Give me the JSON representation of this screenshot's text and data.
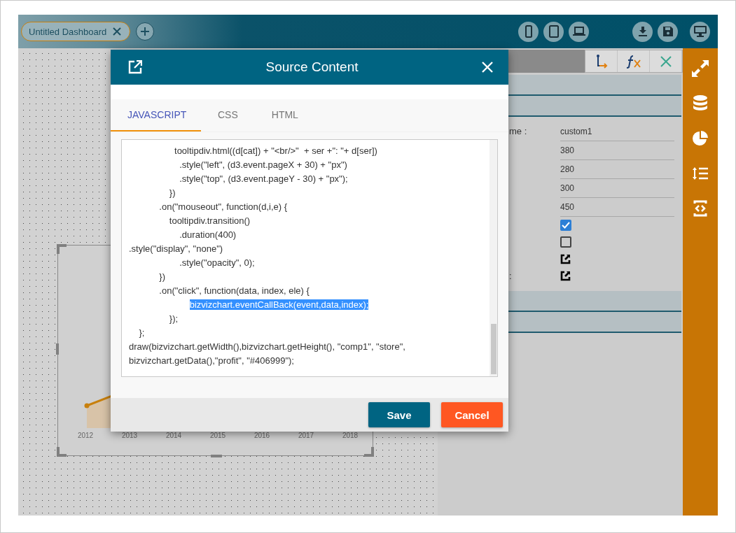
{
  "dashboard_tabs": [
    {
      "label": "Untitled Dashboard",
      "selected": true
    }
  ],
  "chart_widget": {
    "x_labels": [
      "2012",
      "2013",
      "2014",
      "2015",
      "2016",
      "2017",
      "2018"
    ]
  },
  "properties": {
    "rows": [
      {
        "kind": "text",
        "label": "me :",
        "value": "custom1"
      },
      {
        "kind": "text",
        "value": "380"
      },
      {
        "kind": "text",
        "value": "280"
      },
      {
        "kind": "text",
        "value": "300"
      },
      {
        "kind": "text",
        "value": "450"
      },
      {
        "kind": "checkbox",
        "checked": true
      },
      {
        "kind": "checkbox",
        "checked": false
      },
      {
        "kind": "link"
      },
      {
        "kind": "link",
        "label": ":"
      }
    ]
  },
  "modal": {
    "title": "Source Content",
    "tabs": [
      {
        "label": "JAVASCRIPT",
        "selected": true
      },
      {
        "label": "CSS",
        "selected": false
      },
      {
        "label": "HTML",
        "selected": false
      }
    ],
    "code_lines": [
      {
        "text": "                  tooltipdiv.html((d[cat]) + \"<br/>\"  + ser +\": \"+ d[ser])",
        "highlighted": false
      },
      {
        "text": "                    .style(\"left\", (d3.event.pageX + 30) + \"px\")",
        "highlighted": false
      },
      {
        "text": "                    .style(\"top\", (d3.event.pageY - 30) + \"px\");",
        "highlighted": false
      },
      {
        "text": "                })",
        "highlighted": false
      },
      {
        "text": "            .on(\"mouseout\", function(d,i,e) {",
        "highlighted": false
      },
      {
        "text": "                tooltipdiv.transition()",
        "highlighted": false
      },
      {
        "text": "                    .duration(400)",
        "highlighted": false
      },
      {
        "text": ".style(\"display\", \"none\")",
        "highlighted": false
      },
      {
        "text": "                    .style(\"opacity\", 0);",
        "highlighted": false
      },
      {
        "text": "            })",
        "highlighted": false
      },
      {
        "text": "            .on(\"click\", function(data, index, ele) {",
        "highlighted": false
      },
      {
        "text": "                        bizvizchart.eventCallBack(event,data,index);",
        "highlighted": true
      },
      {
        "text": "                });",
        "highlighted": false
      },
      {
        "text": "    };",
        "highlighted": false
      },
      {
        "text": "draw(bizvizchart.getWidth(),bizvizchart.getHeight(), \"comp1\", \"store\",",
        "highlighted": false
      },
      {
        "text": "bizvizchart.getData(),\"profit\", \"#406999\");",
        "highlighted": false
      }
    ],
    "buttons": [
      {
        "label": "Save",
        "kind": "primary"
      },
      {
        "label": "Cancel",
        "kind": "danger"
      }
    ]
  }
}
